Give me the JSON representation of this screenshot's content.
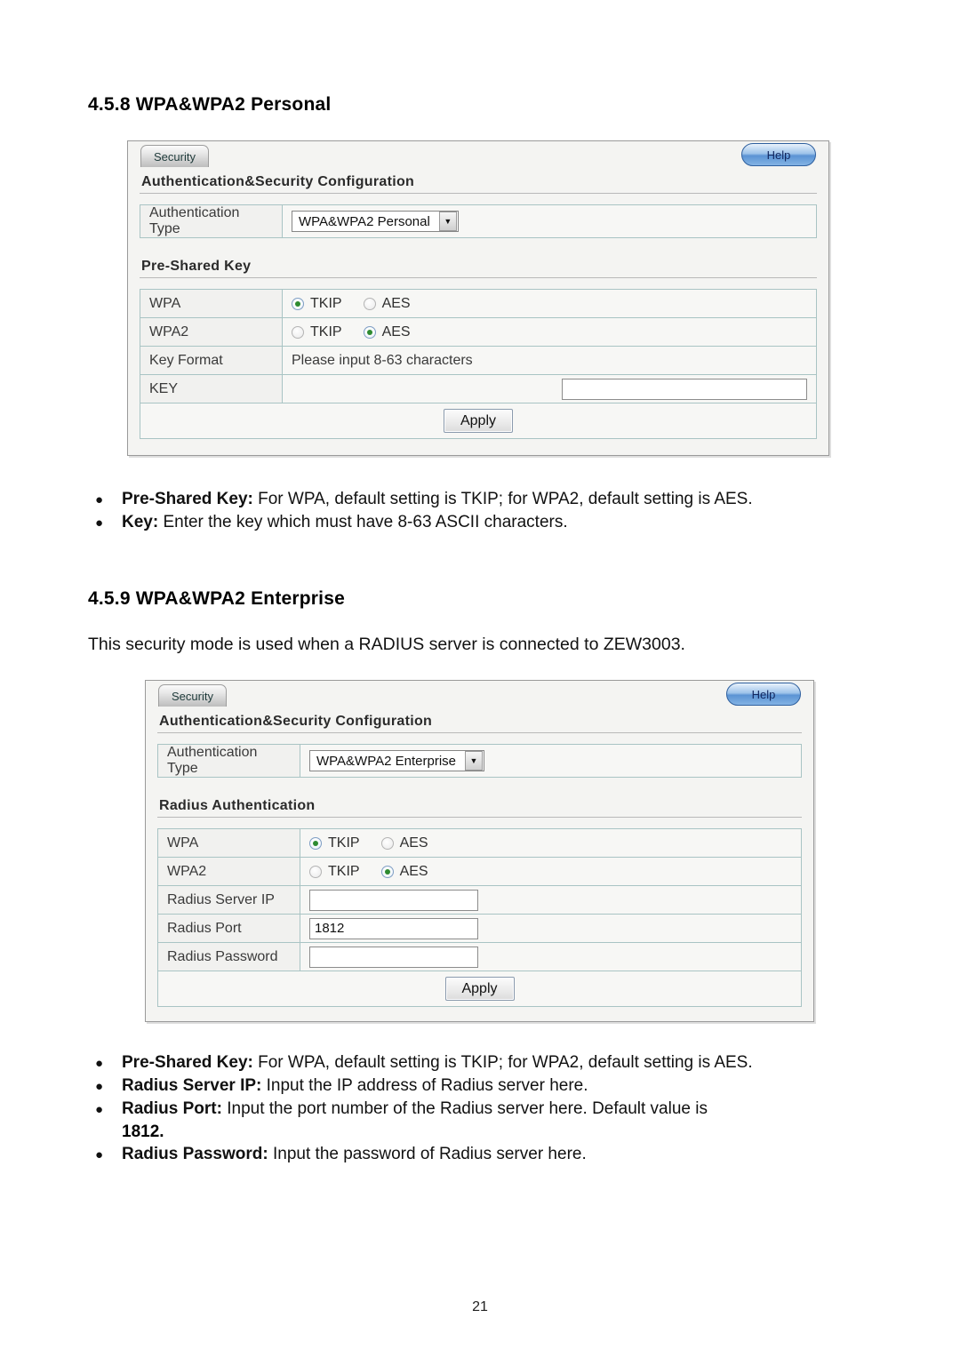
{
  "page": {
    "number": "21"
  },
  "sections": [
    {
      "heading": "4.5.8 WPA&WPA2 Personal",
      "intro": "",
      "bullets": [
        {
          "term": "Pre-Shared Key:",
          "text": " For WPA, default setting is TKIP; for WPA2, default setting is AES."
        },
        {
          "term": "Key:",
          "text": " Enter the key which must have 8-63 ASCII characters."
        }
      ]
    },
    {
      "heading": "4.5.9 WPA&WPA2 Enterprise",
      "intro": "This security mode is used when a RADIUS server is connected to ZEW3003.",
      "bullets": [
        {
          "term": "Pre-Shared Key:",
          "text": " For WPA, default setting is TKIP; for WPA2, default setting is AES."
        },
        {
          "term": "Radius Server IP:",
          "text": " Input the IP address of Radius server here."
        },
        {
          "term": "Radius Port:",
          "text": " Input the port number of the Radius server here. Default value is",
          "continuation": "1812."
        },
        {
          "term": "Radius Password:",
          "text": "  Input the password of Radius server here."
        }
      ]
    }
  ],
  "panel_personal": {
    "tab_label": "Security",
    "help_label": "Help",
    "group_title": "Authentication&Security Configuration",
    "auth_row_label": "Authentication Type",
    "auth_selected": "WPA&WPA2 Personal",
    "auth_arrow_icon": "chevron-down-icon",
    "second_group_title": "Pre-Shared Key",
    "rows": [
      {
        "label": "WPA",
        "type": "radios",
        "options": [
          {
            "label": "TKIP",
            "checked": true
          },
          {
            "label": "AES",
            "checked": false
          }
        ]
      },
      {
        "label": "WPA2",
        "type": "radios",
        "options": [
          {
            "label": "TKIP",
            "checked": false
          },
          {
            "label": "AES",
            "checked": true
          }
        ]
      },
      {
        "label": "Key Format",
        "type": "text",
        "value": "Please input 8-63 characters"
      },
      {
        "label": "KEY",
        "type": "input",
        "value": "",
        "placeholder": ""
      }
    ],
    "apply_label": "Apply"
  },
  "panel_enterprise": {
    "tab_label": "Security",
    "help_label": "Help",
    "group_title": "Authentication&Security Configuration",
    "auth_row_label": "Authentication Type",
    "auth_selected": "WPA&WPA2 Enterprise",
    "auth_arrow_icon": "chevron-down-icon",
    "second_group_title": "Radius Authentication",
    "rows": [
      {
        "label": "WPA",
        "type": "radios",
        "options": [
          {
            "label": "TKIP",
            "checked": true
          },
          {
            "label": "AES",
            "checked": false
          }
        ]
      },
      {
        "label": "WPA2",
        "type": "radios",
        "options": [
          {
            "label": "TKIP",
            "checked": false
          },
          {
            "label": "AES",
            "checked": true
          }
        ]
      },
      {
        "label": "Radius Server IP",
        "type": "input",
        "value": "",
        "placeholder": ""
      },
      {
        "label": "Radius Port",
        "type": "input",
        "value": "1812",
        "placeholder": ""
      },
      {
        "label": "Radius Password",
        "type": "input",
        "value": "",
        "placeholder": ""
      }
    ],
    "apply_label": "Apply"
  }
}
